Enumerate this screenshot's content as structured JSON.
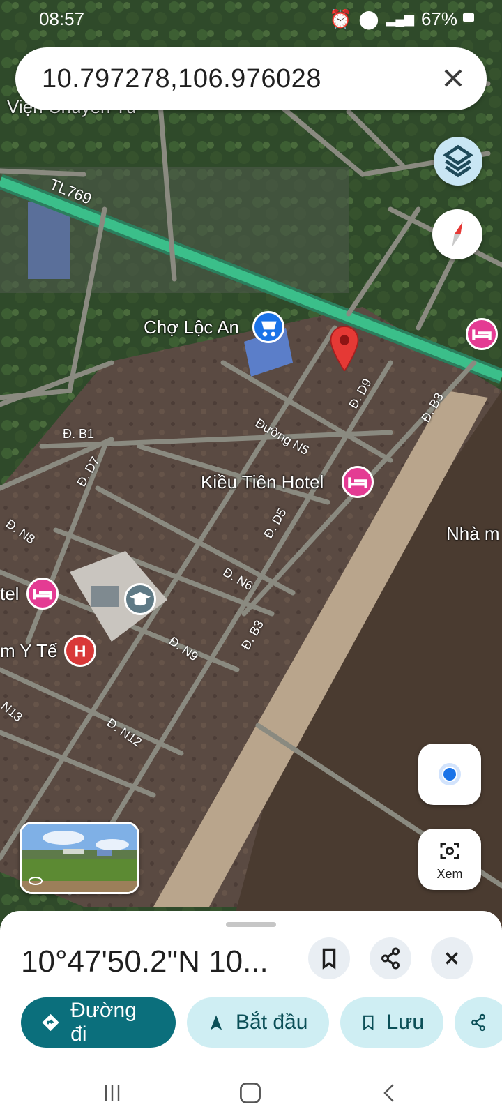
{
  "status_bar": {
    "time": "08:57",
    "battery": "67%"
  },
  "search": {
    "query": "10.797278,106.976028"
  },
  "map": {
    "road_labels": [
      "TL769",
      "Đ. B1",
      "Đ. D7",
      "Đ. N8",
      "Đ. D9",
      "Đ. B3",
      "Đường N5",
      "Đ. D5",
      "Đ. N6",
      "Đ. B3",
      "Đ. N9",
      "Đ. N12",
      "N13"
    ],
    "places": {
      "market": "Chợ Lộc An",
      "hotel_kieu_tien": "Kiều Tiên Hotel",
      "vien_partial": "Viện Chuyển Tử",
      "hotel_partial": "tel",
      "health_partial": "m Y Tế",
      "nha_partial": "Nhà m"
    },
    "colors": {
      "highway": "#3bbf8a",
      "road": "#8a8a80",
      "pin": "#e53935",
      "hotel": "#e43b93",
      "market": "#1a73e8",
      "hospital": "#d93838"
    }
  },
  "buttons": {
    "lens_label": "Xem"
  },
  "sheet": {
    "coordinates": "10°47'50.2\"N 10...",
    "actions": {
      "directions": "Đường đi",
      "start": "Bắt đầu",
      "save": "Lưu"
    }
  },
  "icons": [
    "layers-icon",
    "compass-icon",
    "my-location-icon",
    "lens-icon",
    "bookmark-icon",
    "share-icon",
    "close-icon",
    "directions-icon",
    "navigation-icon",
    "back-icon",
    "home-icon",
    "recents-icon"
  ]
}
